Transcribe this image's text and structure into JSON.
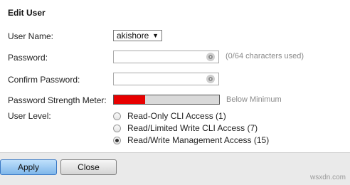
{
  "panel": {
    "title": "Edit User"
  },
  "fields": {
    "username_label": "User Name:",
    "username_value": "akishore",
    "password_label": "Password:",
    "password_hint": "(0/64 characters used)",
    "confirm_label": "Confirm Password:",
    "strength_label": "Password Strength Meter:",
    "strength_text": "Below Minimum",
    "strength_fraction": 0.3,
    "strength_color": "#e80000",
    "level_label": "User Level:"
  },
  "user_levels": [
    {
      "label": "Read-Only CLI Access (1)",
      "checked": false
    },
    {
      "label": "Read/Limited Write CLI Access (7)",
      "checked": false
    },
    {
      "label": "Read/Write Management Access (15)",
      "checked": true
    }
  ],
  "buttons": {
    "apply": "Apply",
    "close": "Close"
  },
  "watermark": "wsxdn.com",
  "icons": {
    "select_arrow": "chevron-down-icon",
    "password_eye": "eye-icon"
  }
}
